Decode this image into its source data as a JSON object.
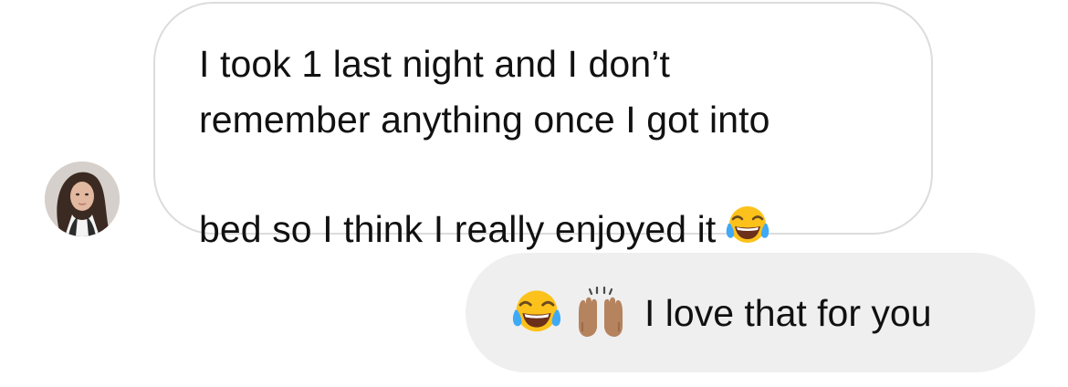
{
  "conversation": {
    "incoming": {
      "avatar_icon": "user-avatar",
      "text": "I took 1 last night and I don’t\nremember anything once I got into\nbed so I think I really enjoyed it",
      "emoji": "face-with-tears-of-joy-icon"
    },
    "outgoing": {
      "emojis": [
        "face-with-tears-of-joy-icon",
        "raising-hands-icon"
      ],
      "text": "I love that for you"
    }
  },
  "colors": {
    "incoming_border": "#dcdcdc",
    "outgoing_bg": "#efefef",
    "text": "#111111"
  }
}
